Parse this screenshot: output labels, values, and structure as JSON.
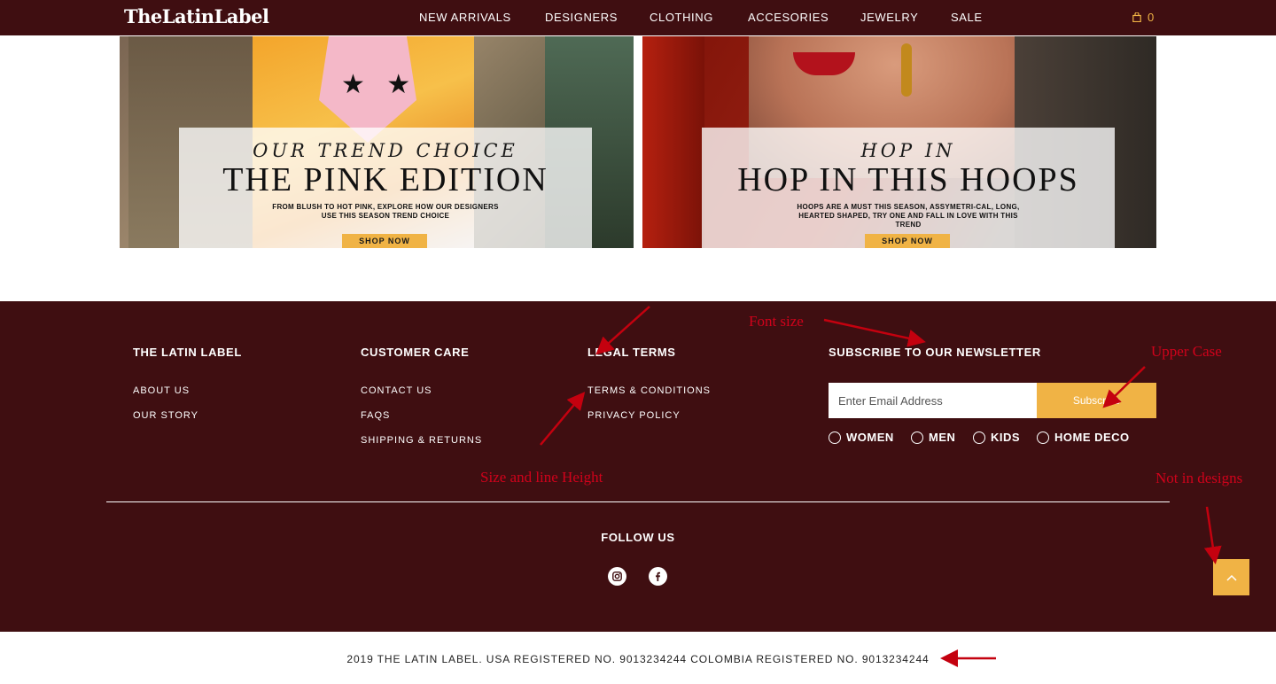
{
  "header": {
    "logo": "TheLatinLabel",
    "nav": [
      "NEW ARRIVALS",
      "DESIGNERS",
      "CLOTHING",
      "ACCESORIES",
      "JEWELRY",
      "SALE"
    ],
    "cart_count": "0",
    "cart_icon": "shopping-bag-icon"
  },
  "banners": [
    {
      "subtitle": "OUR TREND CHOICE",
      "title": "THE PINK EDITION",
      "text": "FROM BLUSH TO HOT PINK, EXPLORE HOW OUR DESIGNERS USE THIS SEASON TREND CHOICE",
      "button": "SHOP NOW"
    },
    {
      "subtitle": "HOP IN",
      "title": "HOP IN THIS HOOPS",
      "text": "HOOPS ARE A MUST THIS SEASON, ASSYMETRI-CAL, LONG, HEARTED SHAPED, TRY ONE AND FALL IN LOVE WITH THIS TREND",
      "button": "SHOP NOW"
    }
  ],
  "footer": {
    "col1": {
      "heading": "THE LATIN LABEL",
      "links": [
        "ABOUT US",
        "OUR STORY"
      ]
    },
    "col2": {
      "heading": "CUSTOMER CARE",
      "links": [
        "CONTACT US",
        "FAQS",
        "SHIPPING & RETURNS"
      ]
    },
    "col3": {
      "heading": "LEGAL TERMS",
      "links": [
        "TERMS & CONDITIONS",
        "PRIVACY POLICY"
      ]
    },
    "newsletter": {
      "heading": "SUBSCRIBE TO OUR NEWSLETTER",
      "placeholder": "Enter Email Address",
      "button": "Subscribe",
      "options": [
        "WOMEN",
        "MEN",
        "KIDS",
        "HOME DECO"
      ]
    },
    "follow": "FOLLOW US",
    "social_icons": [
      "instagram-icon",
      "facebook-icon"
    ],
    "back_to_top_icon": "chevron-up-icon"
  },
  "copyright": "2019 THE LATIN LABEL. USA REGISTERED NO. 9013234244 COLOMBIA REGISTERED NO. 9013234244",
  "annotations": {
    "font_size": "Font size",
    "upper_case": "Upper Case",
    "size_line_height": "Size and line Height",
    "not_in_designs": "Not in designs"
  },
  "colors": {
    "brand_dark": "#3f0e11",
    "accent": "#f0b345",
    "annotation": "#d0021b"
  }
}
